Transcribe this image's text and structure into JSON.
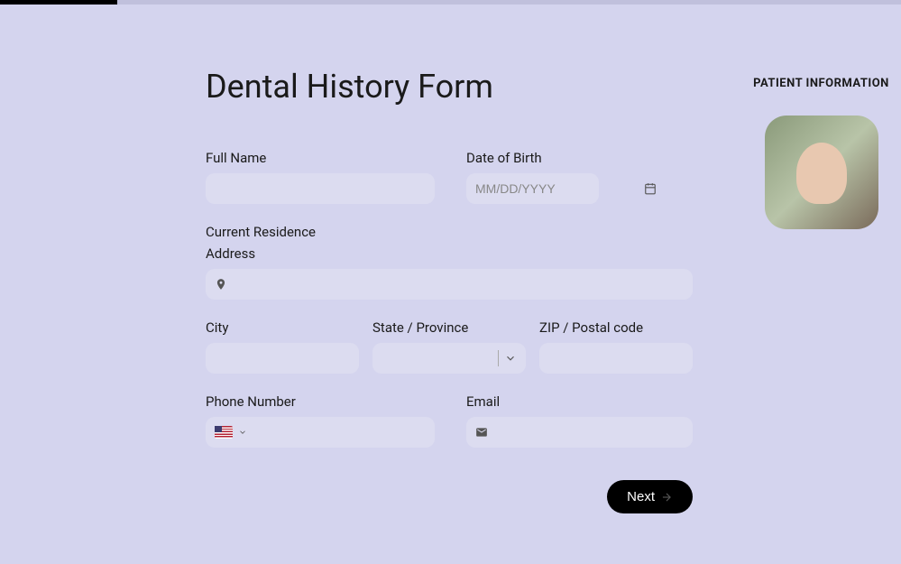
{
  "progress": {
    "percent": 13
  },
  "title": "Dental History Form",
  "section_label": "PATIENT INFORMATION",
  "labels": {
    "full_name": "Full Name",
    "dob": "Date of Birth",
    "dob_placeholder": "MM/DD/YYYY",
    "current_residence": "Current Residence",
    "address": "Address",
    "city": "City",
    "state": "State / Province",
    "zip": "ZIP / Postal code",
    "phone": "Phone Number",
    "email": "Email"
  },
  "values": {
    "full_name": "",
    "dob": "",
    "address": "",
    "city": "",
    "state": "",
    "zip": "",
    "phone": "",
    "email": ""
  },
  "phone_country": "US",
  "next_button": "Next"
}
